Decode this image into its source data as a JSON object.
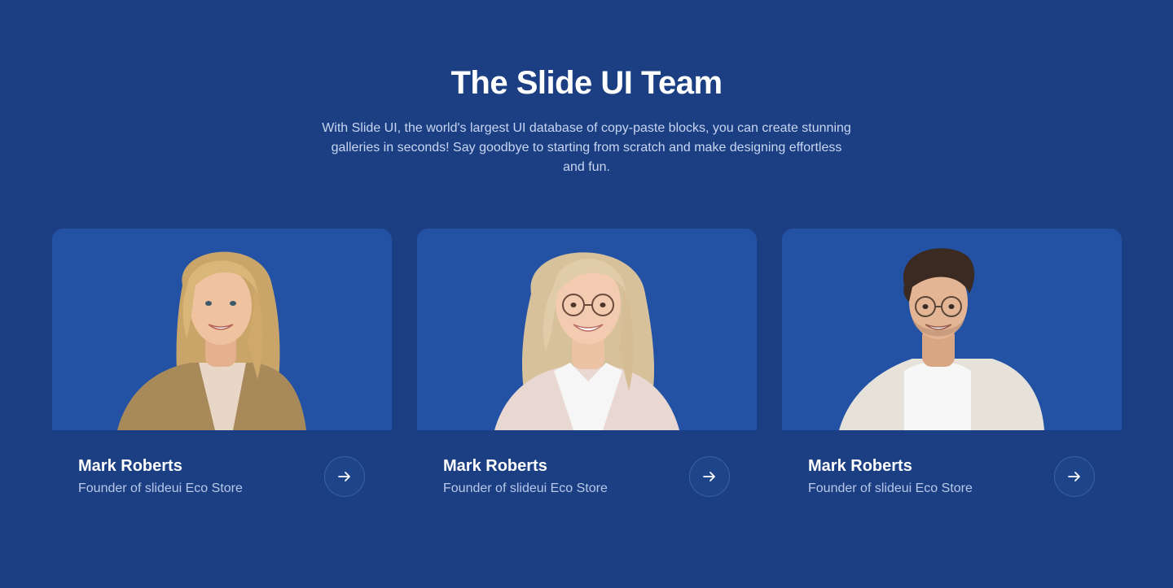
{
  "section": {
    "title": "The Slide UI Team",
    "description": "With Slide UI, the world's largest UI database of copy-paste blocks, you can create stunning galleries in seconds! Say goodbye to starting from scratch and make designing effortless and fun."
  },
  "team": [
    {
      "name": "Mark Roberts",
      "role": "Founder of slideui Eco Store"
    },
    {
      "name": "Mark Roberts",
      "role": "Founder of slideui Eco Store"
    },
    {
      "name": "Mark Roberts",
      "role": "Founder of slideui Eco Store"
    }
  ],
  "icons": {
    "card_action": "arrow-right-icon",
    "portrait": "person-photo"
  },
  "colors": {
    "background": "#1b3f82",
    "card_photo_bg": "#2352a5",
    "text": "#ffffff",
    "muted_text": "#b9c8ea"
  }
}
